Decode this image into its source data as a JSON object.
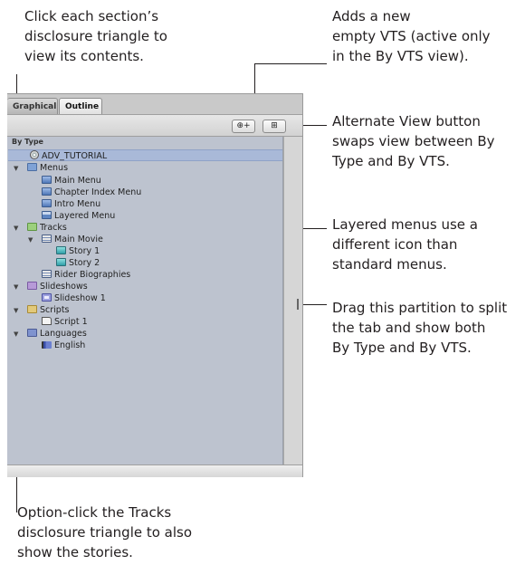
{
  "callouts": {
    "top_left": "Click each section’s\ndisclosure triangle to\nview its contents.",
    "top_right": "Adds a new\nempty VTS (active only\nin the By VTS view).",
    "alt_view": "Alternate View button\nswaps view between By\nType and By VTS.",
    "layered": "Layered menus use a\ndifferent icon than\nstandard menus.",
    "partition": "Drag this partition to split\nthe tab and show both\nBy Type and By VTS.",
    "bottom": "Option-click the Tracks\ndisclosure triangle to also\nshow the stories."
  },
  "tabs": {
    "graphical": "Graphical",
    "outline": "Outline"
  },
  "toolbar": {
    "add_vts_label": "⊕+",
    "alt_view_label": "⊞"
  },
  "outline": {
    "header": "By Type",
    "rows": [
      {
        "label": "ADV_TUTORIAL",
        "icon": "disc-icon"
      },
      {
        "label": "Menus",
        "icon": "folder-icon"
      },
      {
        "label": "Main Menu",
        "icon": "menu-icon"
      },
      {
        "label": "Chapter Index Menu",
        "icon": "menu-icon"
      },
      {
        "label": "Intro Menu",
        "icon": "menu-icon"
      },
      {
        "label": "Layered Menu",
        "icon": "layered-menu-icon"
      },
      {
        "label": "Tracks",
        "icon": "folder-icon"
      },
      {
        "label": "Main Movie",
        "icon": "track-icon"
      },
      {
        "label": "Story 1",
        "icon": "story-icon"
      },
      {
        "label": "Story 2",
        "icon": "story-icon"
      },
      {
        "label": "Rider Biographies",
        "icon": "track-icon"
      },
      {
        "label": "Slideshows",
        "icon": "folder-icon"
      },
      {
        "label": "Slideshow 1",
        "icon": "slideshow-icon"
      },
      {
        "label": "Scripts",
        "icon": "folder-icon"
      },
      {
        "label": "Script 1",
        "icon": "script-icon"
      },
      {
        "label": "Languages",
        "icon": "folder-icon"
      },
      {
        "label": "English",
        "icon": "flag-icon"
      }
    ]
  },
  "colors": {
    "list_background": "#bdc3cf",
    "selection": "#a9b9d8",
    "folder_menus": "#7fa2d6",
    "folder_tracks": "#9cd07d",
    "folder_slideshows": "#b79ad8",
    "folder_scripts": "#e2c97a",
    "folder_languages": "#7f93cf"
  }
}
